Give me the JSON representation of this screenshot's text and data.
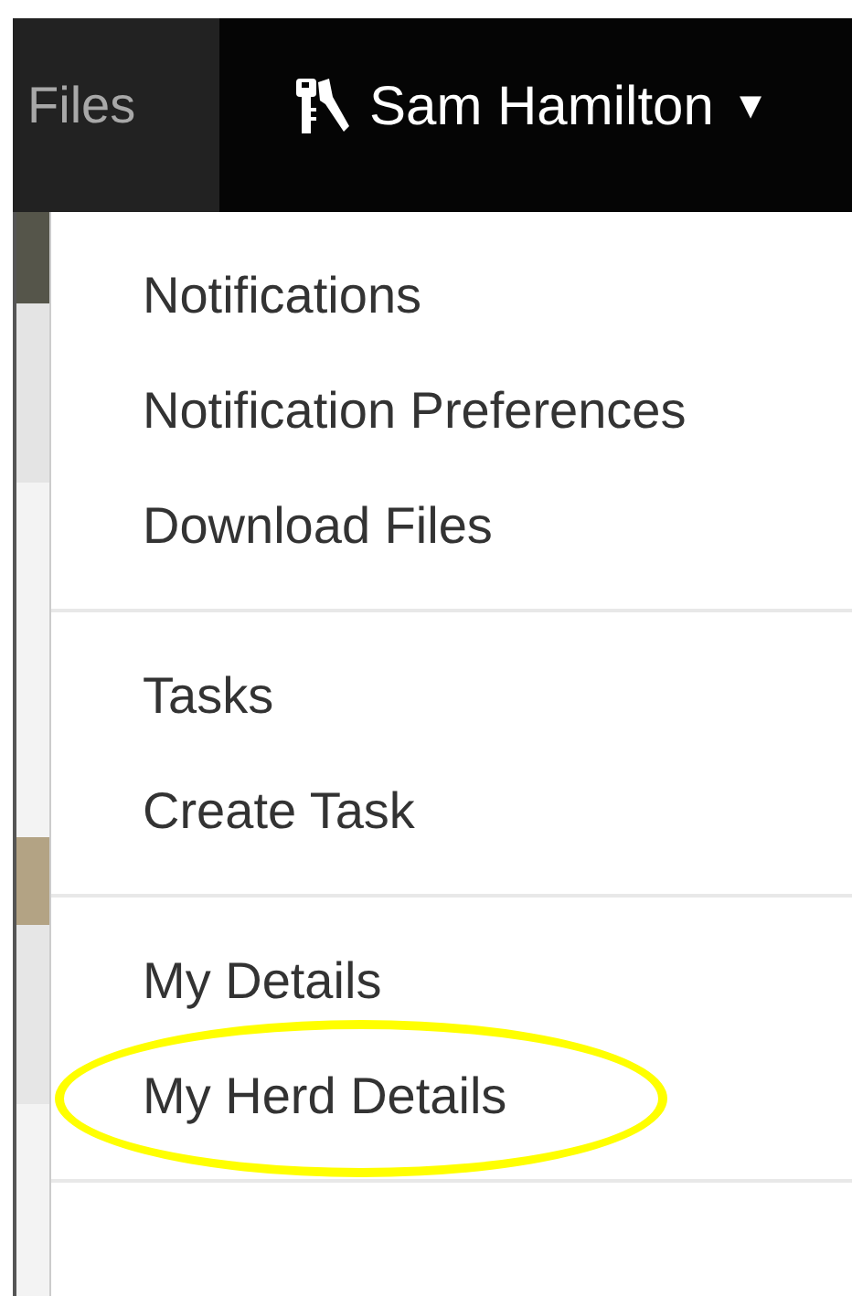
{
  "navbar": {
    "files_label": "Files",
    "user_name": "Sam Hamilton",
    "caret": "▾"
  },
  "menu": {
    "groups": [
      {
        "items": [
          {
            "label": "Notifications",
            "circled": false
          },
          {
            "label": "Notification Preferences",
            "circled": false
          },
          {
            "label": "Download Files",
            "circled": false
          }
        ]
      },
      {
        "items": [
          {
            "label": "Tasks",
            "circled": false
          },
          {
            "label": "Create Task",
            "circled": false
          }
        ]
      },
      {
        "items": [
          {
            "label": "My Details",
            "circled": false
          },
          {
            "label": "My Herd Details",
            "circled": true
          }
        ]
      }
    ]
  }
}
